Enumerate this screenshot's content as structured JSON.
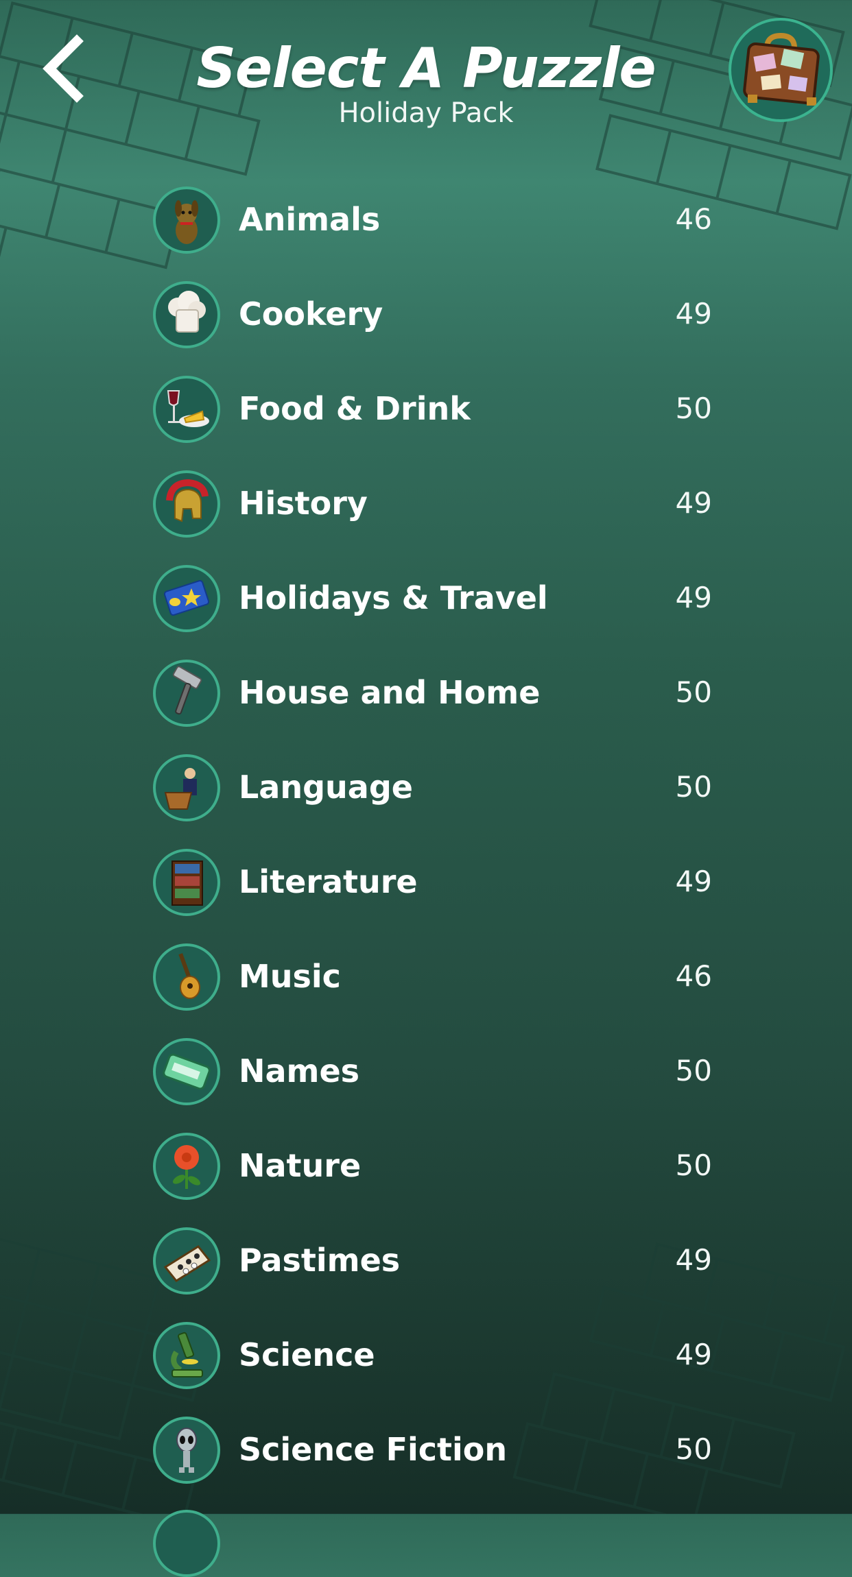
{
  "header": {
    "title": "Select A Puzzle",
    "subtitle": "Holiday Pack",
    "back_icon": "chevron-left-icon",
    "pack_icon": "suitcase-icon"
  },
  "colors": {
    "background_top": "#3f8671",
    "background_bottom": "#162e27",
    "icon_ring": "#3fae8c",
    "text": "#ffffff"
  },
  "categories": [
    {
      "label": "Animals",
      "count": "46",
      "icon": "dog-icon"
    },
    {
      "label": "Cookery",
      "count": "49",
      "icon": "chef-hat-icon"
    },
    {
      "label": "Food & Drink",
      "count": "50",
      "icon": "wine-cheese-icon"
    },
    {
      "label": "History",
      "count": "49",
      "icon": "roman-helmet-icon"
    },
    {
      "label": "Holidays & Travel",
      "count": "49",
      "icon": "airmail-envelope-icon"
    },
    {
      "label": "House and Home",
      "count": "50",
      "icon": "hammer-icon"
    },
    {
      "label": "Language",
      "count": "50",
      "icon": "speaker-podium-icon"
    },
    {
      "label": "Literature",
      "count": "49",
      "icon": "bookcase-icon"
    },
    {
      "label": "Music",
      "count": "46",
      "icon": "guitar-icon"
    },
    {
      "label": "Names",
      "count": "50",
      "icon": "name-badge-icon"
    },
    {
      "label": "Nature",
      "count": "50",
      "icon": "flower-icon"
    },
    {
      "label": "Pastimes",
      "count": "49",
      "icon": "checkers-board-icon"
    },
    {
      "label": "Science",
      "count": "49",
      "icon": "microscope-icon"
    },
    {
      "label": "Science Fiction",
      "count": "50",
      "icon": "alien-icon"
    }
  ]
}
